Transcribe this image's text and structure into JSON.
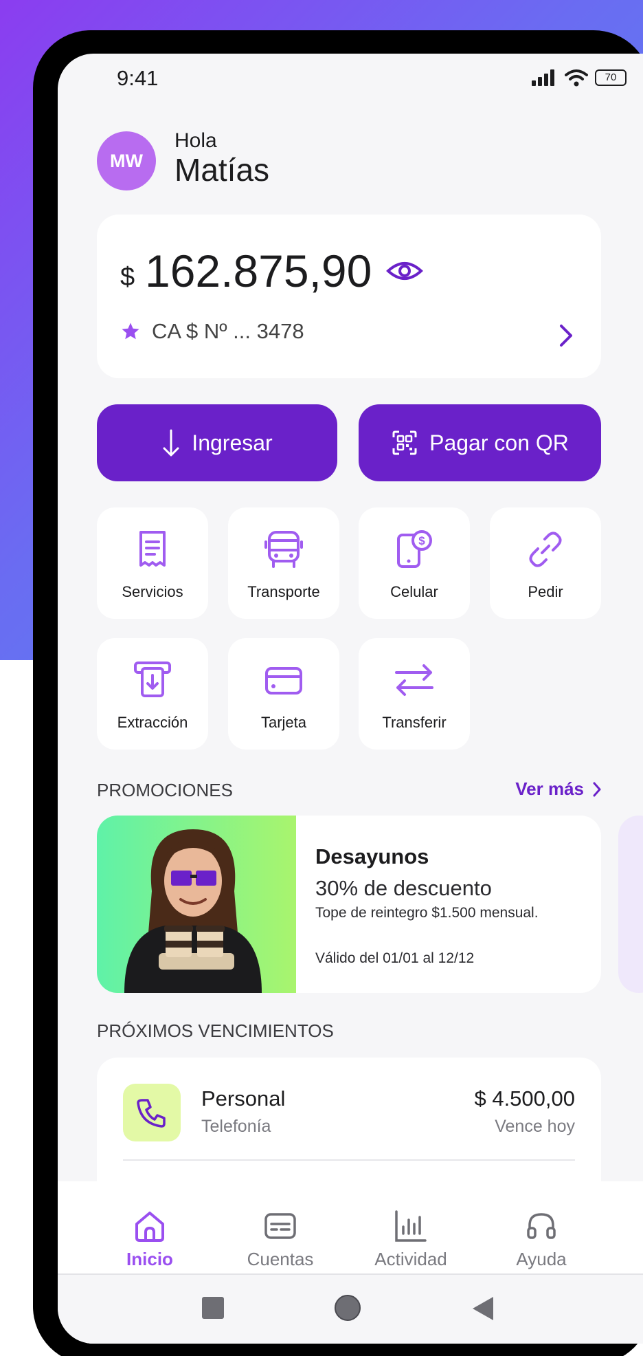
{
  "status_bar": {
    "time": "9:41",
    "battery": "70"
  },
  "user": {
    "initials": "MW",
    "greeting": "Hola",
    "name": "Matías"
  },
  "balance": {
    "currency": "$",
    "amount": "162.875,90",
    "account": "CA $ Nº ... 3478"
  },
  "actions": {
    "deposit": "Ingresar",
    "pay_qr": "Pagar con QR"
  },
  "shortcuts": [
    {
      "label": "Servicios",
      "icon": "receipt-icon"
    },
    {
      "label": "Transporte",
      "icon": "bus-icon"
    },
    {
      "label": "Celular",
      "icon": "phone-topup-icon"
    },
    {
      "label": "Pedir",
      "icon": "link-icon"
    },
    {
      "label": "Extracción",
      "icon": "atm-withdraw-icon"
    },
    {
      "label": "Tarjeta",
      "icon": "card-icon"
    },
    {
      "label": "Transferir",
      "icon": "transfer-icon"
    }
  ],
  "promotions": {
    "title": "PROMOCIONES",
    "see_more": "Ver más",
    "card": {
      "title": "Desayunos",
      "discount": "30% de descuento",
      "cap": "Tope de reintegro $1.500 mensual.",
      "validity": "Válido del 01/01 al 12/12"
    }
  },
  "bills": {
    "title": "PRÓXIMOS VENCIMIENTOS",
    "items": [
      {
        "name": "Personal",
        "category": "Telefonía",
        "amount": "$ 4.500,00",
        "due": "Vence hoy"
      }
    ]
  },
  "bottom_nav": [
    {
      "label": "Inicio",
      "active": true
    },
    {
      "label": "Cuentas",
      "active": false
    },
    {
      "label": "Actividad",
      "active": false
    },
    {
      "label": "Ayuda",
      "active": false
    }
  ],
  "colors": {
    "primary": "#6a21c9",
    "accent": "#9a4ff0",
    "tile_icon": "#a05cf0"
  }
}
